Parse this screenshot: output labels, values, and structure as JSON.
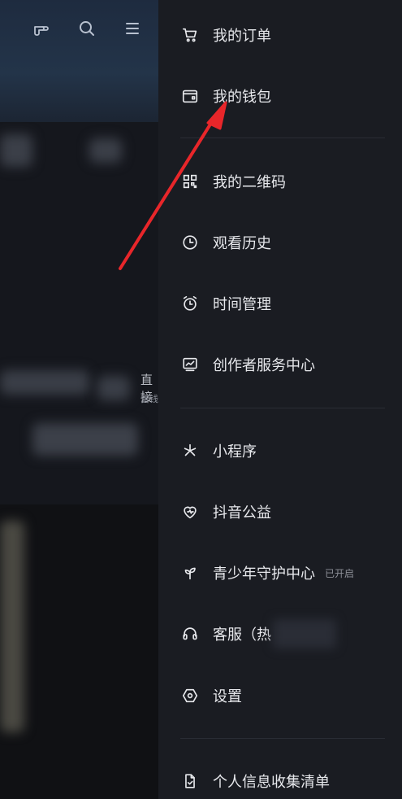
{
  "background": {
    "top_icons": [
      "hand-pointer-icon",
      "search-icon",
      "menu-icon"
    ],
    "side_text": "直接",
    "side_subtext": "富钱"
  },
  "drawer": {
    "group1": [
      {
        "label": "我的订单",
        "icon": "cart-icon"
      },
      {
        "label": "我的钱包",
        "icon": "wallet-icon"
      }
    ],
    "group2": [
      {
        "label": "我的二维码",
        "icon": "qr-code-icon"
      },
      {
        "label": "观看历史",
        "icon": "clock-icon"
      },
      {
        "label": "时间管理",
        "icon": "alarm-clock-icon"
      },
      {
        "label": "创作者服务中心",
        "icon": "chart-icon"
      }
    ],
    "group3": [
      {
        "label": "小程序",
        "icon": "asterisk-icon"
      },
      {
        "label": "抖音公益",
        "icon": "heart-icon"
      },
      {
        "label": "青少年守护中心",
        "icon": "sprout-icon",
        "badge": "已开启"
      },
      {
        "label": "客服（热",
        "icon": "headset-icon"
      },
      {
        "label": "设置",
        "icon": "settings-icon"
      }
    ],
    "group4": [
      {
        "label": "个人信息收集清单",
        "icon": "document-icon"
      }
    ]
  },
  "annotation": {
    "color": "#e8262a",
    "target": "我的钱包"
  }
}
